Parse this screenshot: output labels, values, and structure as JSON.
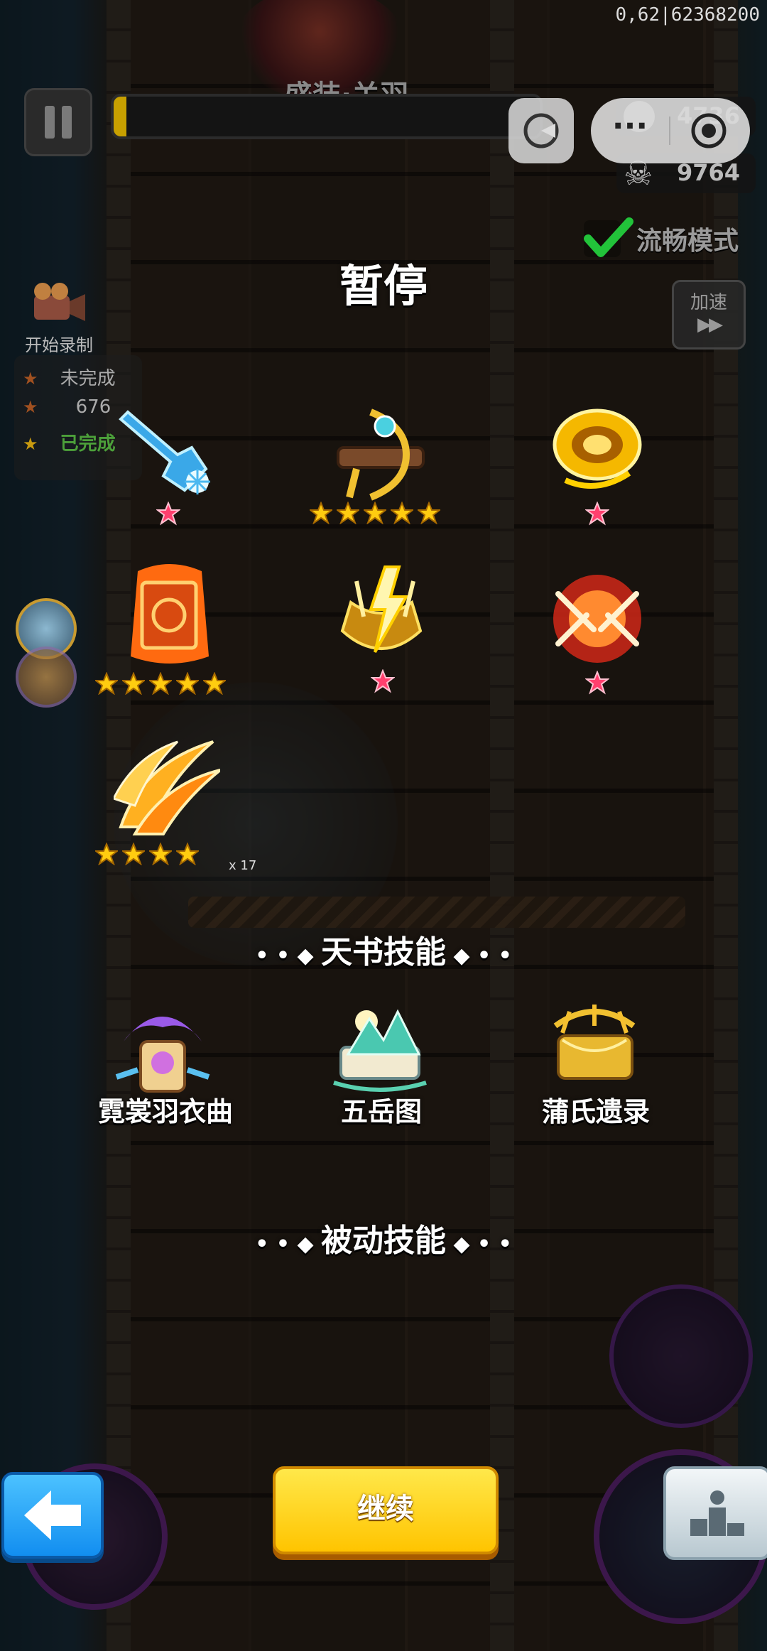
{
  "hud": {
    "debug_id": "0,62|62368200",
    "boss_name": "盛装·关羽",
    "coin_count": "4736",
    "kill_count": "9764",
    "smooth_mode_label": "流畅模式",
    "speed_up_label": "加速",
    "speed_up_arrows": "▶▶",
    "record_label": "开始录制",
    "tasks": [
      {
        "label": "未完成"
      },
      {
        "label": "676"
      },
      {
        "label": "已完成"
      }
    ],
    "combo_text": "x 17",
    "menu_dots": "···"
  },
  "pause": {
    "title": "暂停",
    "active_skills": [
      {
        "name": "ice-blade-skill",
        "stars": 0,
        "gem": true
      },
      {
        "name": "golden-crossbow-skill",
        "stars": 5,
        "gem": false
      },
      {
        "name": "golden-whirlwind-skill",
        "stars": 0,
        "gem": true
      },
      {
        "name": "fire-scroll-skill",
        "stars": 5,
        "gem": false
      },
      {
        "name": "thunder-strike-skill",
        "stars": 0,
        "gem": true
      },
      {
        "name": "fire-arrows-skill",
        "stars": 0,
        "gem": true
      },
      {
        "name": "flame-claw-skill",
        "stars": 4,
        "gem": false
      }
    ],
    "book_section_title": "天书技能",
    "books": [
      {
        "label": "霓裳羽衣曲"
      },
      {
        "label": "五岳图"
      },
      {
        "label": "蒲氏遗录"
      }
    ],
    "passive_section_title": "被动技能",
    "continue_label": "继续"
  },
  "colors": {
    "gold": "#ffd21f",
    "gold_dark": "#e08a00",
    "blue_btn": "#1b9cff",
    "gem_pink": "#ff3f6e",
    "check_green": "#22c33a"
  }
}
